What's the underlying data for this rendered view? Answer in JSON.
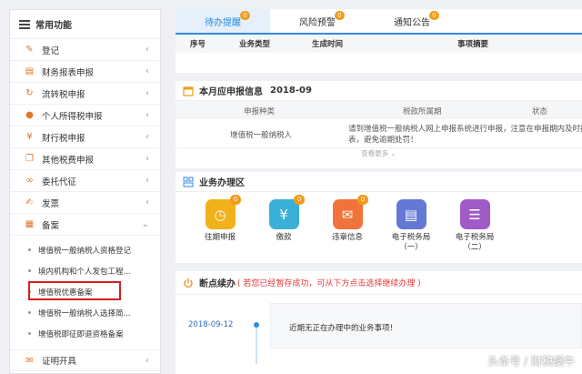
{
  "sidebar": {
    "title": "常用功能",
    "items": [
      {
        "label": "登记",
        "icon": "edit-icon"
      },
      {
        "label": "财务报表申报",
        "icon": "report-icon"
      },
      {
        "label": "流转税申报",
        "icon": "cycle-icon"
      },
      {
        "label": "个人所得税申报",
        "icon": "person-icon"
      },
      {
        "label": "财行税申报",
        "icon": "tax-icon"
      },
      {
        "label": "其他税费申报",
        "icon": "copy-icon"
      },
      {
        "label": "委托代征",
        "icon": "link-icon"
      },
      {
        "label": "发票",
        "icon": "invoice-icon"
      },
      {
        "label": "备案",
        "icon": "grid-icon"
      }
    ],
    "sub_items": [
      "增值税一般纳税人资格登记",
      "境内机构和个人发包工程...",
      "增值税优惠备案",
      "增值税一般纳税人选择简...",
      "增值税即征即退资格备案"
    ],
    "last_item": {
      "label": "证明开具",
      "icon": "certificate-icon"
    }
  },
  "tabs": [
    {
      "label": "待办提醒",
      "badge": "0",
      "active": true
    },
    {
      "label": "风险预警",
      "badge": "0",
      "active": false
    },
    {
      "label": "通知公告",
      "badge": "0",
      "active": false
    }
  ],
  "todo_columns": [
    "序号",
    "业务类型",
    "生成时间",
    "事项摘要"
  ],
  "schedule": {
    "title": "本月应申报信息",
    "month": "2018-09",
    "columns": [
      "申报种类",
      "税款所属期",
      "状态"
    ],
    "rows": [
      {
        "type": "增值税一般纳税人",
        "note_line1": "请到增值税一般纳税人网上申报系统进行申报，注意在申报期内及时报",
        "note_line2": "表，避免逾期处罚！"
      }
    ],
    "more_label": "查看更多"
  },
  "business": {
    "title": "业务办理区",
    "items": [
      {
        "label": "往期申报",
        "count": "0",
        "color": "#f1b11b",
        "icon": "clock-icon",
        "glyph": "◷"
      },
      {
        "label": "缴款",
        "count": "0",
        "color": "#3ab0d8",
        "icon": "yen-icon",
        "glyph": "¥"
      },
      {
        "label": "违章信息",
        "count": "0",
        "color": "#f0733a",
        "icon": "mail-icon",
        "glyph": "✉"
      },
      {
        "label": "电子税务局",
        "label2": "（一）",
        "count": "",
        "color": "#6478d6",
        "icon": "documents-icon",
        "glyph": "▤"
      },
      {
        "label": "电子税务局",
        "label2": "（二）",
        "count": "",
        "color": "#a05bc6",
        "icon": "list-icon",
        "glyph": "☰"
      }
    ]
  },
  "resume": {
    "title": "断点续办",
    "hint": "( 若您已经暂存成功，可从下方点击选择继续办理 )",
    "date": "2018-09-12",
    "message": "近期无正在办理中的业务事项！"
  },
  "watermark": "头条号 / 财税蜗牛"
}
